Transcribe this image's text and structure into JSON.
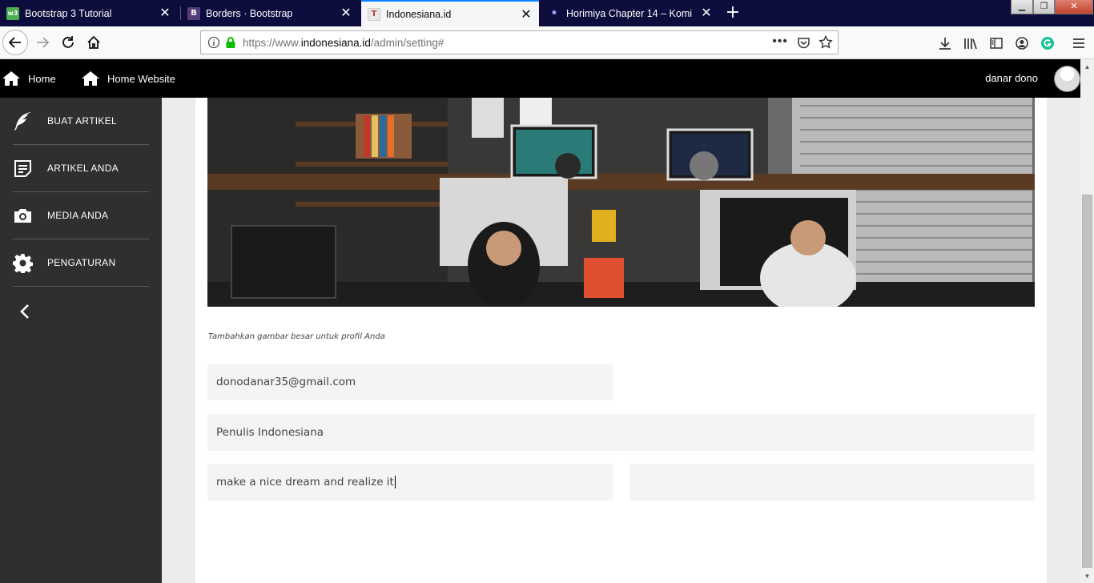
{
  "browser": {
    "tabs": [
      {
        "label": "Bootstrap 3 Tutorial",
        "favicon": "w3",
        "favicon_color": "#4caf50",
        "active": false
      },
      {
        "label": "Borders · Bootstrap",
        "favicon": "B",
        "favicon_color": "#563d7c",
        "active": false
      },
      {
        "label": "Indonesiana.id",
        "favicon": "T",
        "favicon_color": "#e8e8e8",
        "active": true
      },
      {
        "label": "Horimiya Chapter 14 – Komikcast",
        "favicon": "•",
        "favicon_color": "#0c0c3d",
        "active": false
      }
    ],
    "url": {
      "prefix": "https://www.",
      "domain": "indonesiana.id",
      "path": "/admin/setting#"
    },
    "accent_color": "#0a84ff"
  },
  "header": {
    "home_label": "Home",
    "home_website_label": "Home Website",
    "username": "danar dono"
  },
  "sidebar": {
    "items": [
      {
        "label": "BUAT ARTIKEL",
        "icon": "feather-icon"
      },
      {
        "label": "ARTIKEL ANDA",
        "icon": "document-icon"
      },
      {
        "label": "MEDIA ANDA",
        "icon": "camera-icon"
      },
      {
        "label": "PENGATURAN",
        "icon": "gear-icon"
      }
    ],
    "collapse_icon": "chevron-left-icon"
  },
  "profile": {
    "cover_caption": "Tambahkan gambar besar untuk profil Anda",
    "email": "donodanar35@gmail.com",
    "title": "Penulis Indonesiana",
    "bio": "make a nice dream and realize it",
    "extra": ""
  }
}
